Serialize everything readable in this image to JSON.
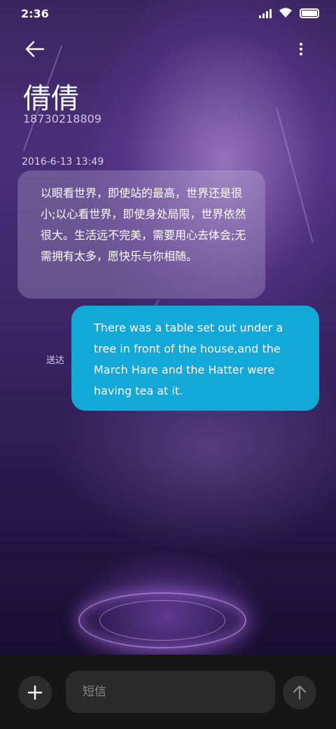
{
  "status_bar": {
    "time": "2:36",
    "icons": [
      "signal-icon",
      "wifi-icon",
      "battery-icon"
    ]
  },
  "header": {
    "back_icon": "back-arrow-icon",
    "more_icon": "more-vertical-icon",
    "contact_name": "倩倩",
    "contact_number": "18730218809"
  },
  "conversation": {
    "timestamp": "2016-6-13 13:49",
    "incoming_message": "以眼看世界，即使站的最高，世界还是很小;以心看世界，即使身处局限，世界依然很大。生活远不完美，需要用心去体会;无需拥有太多，愿快乐与你相随。",
    "outgoing_message": "There was a table set out under a tree in front of the house,and the March Hare and the Hatter were having tea at it.",
    "sent_status": "送达"
  },
  "composer": {
    "add_icon": "plus-icon",
    "placeholder": "短信",
    "send_icon": "arrow-up-icon"
  },
  "colors": {
    "outgoing_bubble": "#12a8d8",
    "input_bar_bg": "#161616"
  }
}
